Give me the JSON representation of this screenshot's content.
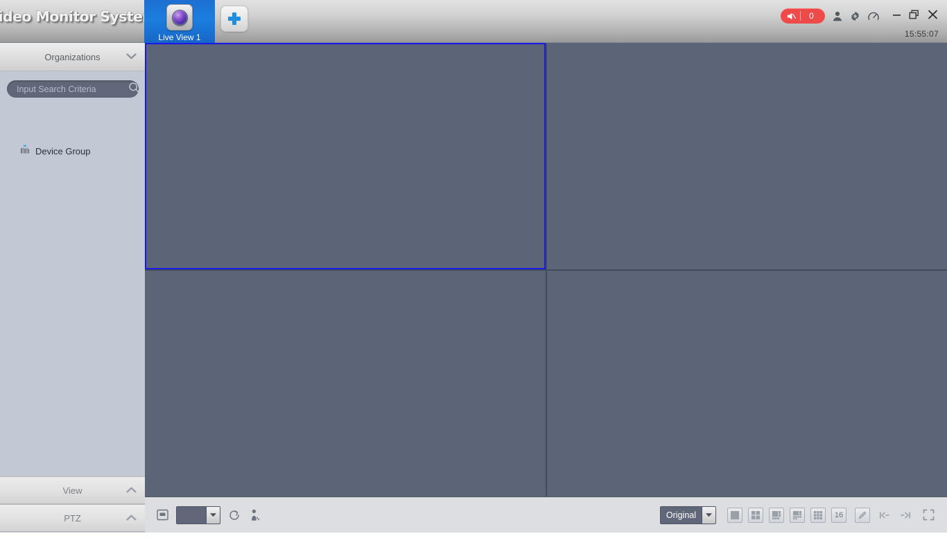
{
  "app": {
    "brand": "Video Monitor System",
    "clock": "15:55:07"
  },
  "titlebar": {
    "alarm_badge": {
      "icon": "speaker-mute-icon",
      "count": "0",
      "color": "#ee4a4a"
    },
    "icons": [
      {
        "name": "user-icon",
        "title": "User"
      },
      {
        "name": "gear-icon",
        "title": "Settings"
      },
      {
        "name": "gauge-icon",
        "title": "Performance"
      }
    ],
    "window_controls": [
      {
        "name": "minimize-button",
        "glyph": "minimize-icon"
      },
      {
        "name": "restore-button",
        "glyph": "restore-icon"
      },
      {
        "name": "close-button",
        "glyph": "close-icon"
      }
    ]
  },
  "tabs": [
    {
      "label": "Live View 1",
      "icon": "camera-lens-icon",
      "active": true
    }
  ],
  "add_tab": {
    "label": "+",
    "icon": "plus-icon"
  },
  "sidebar": {
    "header": {
      "title": "Organizations",
      "chevron": "chevron-down-icon"
    },
    "search": {
      "value": "",
      "placeholder": "Input Search Criteria",
      "icon": "search-icon"
    },
    "tree": [
      {
        "label": "Device Group",
        "icon": "device-group-icon"
      }
    ],
    "sections": [
      {
        "label": "View",
        "chevron": "chevron-up-icon"
      },
      {
        "label": "PTZ",
        "chevron": "chevron-up-icon"
      }
    ]
  },
  "stage": {
    "panes": [
      {
        "index": 1,
        "selected": true
      },
      {
        "index": 2,
        "selected": false
      },
      {
        "index": 3,
        "selected": false
      },
      {
        "index": 4,
        "selected": false
      }
    ],
    "pane_color": "#5c6477",
    "selection_color": "#1a1ae8"
  },
  "bottombar": {
    "left_tools": [
      {
        "name": "snapshot-button",
        "icon": "snapshot-icon"
      },
      {
        "name": "stream-select",
        "icon": "chevron-down-icon",
        "value": ""
      },
      {
        "name": "refresh-button",
        "icon": "refresh-loop-icon"
      },
      {
        "name": "patrol-button",
        "icon": "person-walk-icon"
      }
    ],
    "scale_select": {
      "value": "Original",
      "arrow": "chevron-down-icon"
    },
    "layout_buttons": [
      {
        "name": "layout-1",
        "label": "1"
      },
      {
        "name": "layout-4",
        "label": "4"
      },
      {
        "name": "layout-6",
        "label": "6"
      },
      {
        "name": "layout-8",
        "label": "8"
      },
      {
        "name": "layout-9",
        "label": "9"
      },
      {
        "name": "layout-16",
        "label": "16"
      }
    ],
    "edit_button": {
      "name": "edit-layout-button",
      "icon": "pencil-icon"
    },
    "nav": [
      {
        "name": "prev-page-button",
        "icon": "prev-page-icon"
      },
      {
        "name": "next-page-button",
        "icon": "next-page-icon"
      }
    ],
    "fullscreen_button": {
      "name": "fullscreen-button",
      "icon": "fullscreen-icon"
    }
  }
}
